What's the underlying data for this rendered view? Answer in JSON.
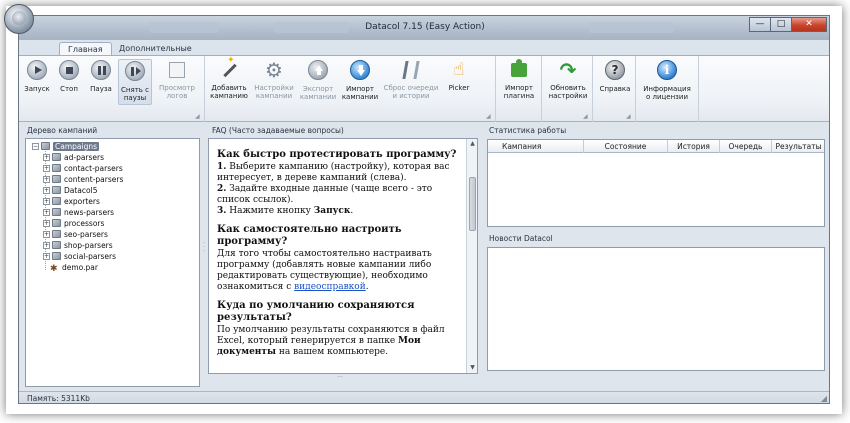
{
  "window": {
    "title": "Datacol 7.15 (Easy Action)",
    "controls": {
      "minimize": "—",
      "maximize": "□",
      "close": "✕"
    }
  },
  "ribbon": {
    "tabs": [
      {
        "label": "Главная",
        "active": true
      },
      {
        "label": "Дополнительные",
        "active": false
      }
    ],
    "buttons": {
      "start": {
        "line1": "Запуск",
        "line2": "",
        "icon": "play-icon",
        "enabled": true
      },
      "stop": {
        "line1": "Стоп",
        "line2": "",
        "icon": "stop-icon",
        "enabled": true
      },
      "pause": {
        "line1": "Пауза",
        "line2": "",
        "icon": "pause-icon",
        "enabled": true
      },
      "resume": {
        "line1": "Снять с",
        "line2": "паузы",
        "icon": "resume-icon",
        "enabled": true
      },
      "view_logs": {
        "line1": "Просмотр",
        "line2": "логов",
        "icon": "log-icon",
        "enabled": false
      },
      "add_campaign": {
        "line1": "Добавить",
        "line2": "кампанию",
        "icon": "wand-icon",
        "enabled": true
      },
      "campaign_settings": {
        "line1": "Настройки",
        "line2": "кампании",
        "icon": "gear-icon",
        "enabled": false
      },
      "export_campaign": {
        "line1": "Экспорт",
        "line2": "кампании",
        "icon": "export-icon",
        "enabled": false
      },
      "import_campaign": {
        "line1": "Импорт",
        "line2": "кампании",
        "icon": "import-icon",
        "enabled": true
      },
      "reset_queue": {
        "line1": "Сброс очереди",
        "line2": "и истории",
        "icon": "reset-icon",
        "enabled": false
      },
      "picker": {
        "line1": "Picker",
        "line2": "",
        "icon": "picker-hand-icon",
        "enabled": true
      },
      "import_plugin": {
        "line1": "Импорт",
        "line2": "плагина",
        "icon": "puzzle-icon",
        "enabled": true
      },
      "update_settings": {
        "line1": "Обновить",
        "line2": "настройки",
        "icon": "refresh-icon",
        "enabled": true
      },
      "help": {
        "line1": "Справка",
        "line2": "",
        "icon": "help-icon",
        "enabled": true
      },
      "license_info": {
        "line1": "Информация",
        "line2": "о лицензии",
        "icon": "info-icon",
        "enabled": true
      }
    }
  },
  "campaign_tree": {
    "header": "Дерево кампаний",
    "root": "Campaigns",
    "folders": [
      "ad-parsers",
      "contact-parsers",
      "content-parsers",
      "Datacol5",
      "exporters",
      "news-parsers",
      "processors",
      "seo-parsers",
      "shop-parsers",
      "social-parsers"
    ],
    "files": [
      "demo.par"
    ]
  },
  "faq": {
    "header": "FAQ (Часто задаваемые вопросы)",
    "q1": {
      "title": "Как быстро протестировать программу?",
      "n1": "1.",
      "s1": " Выберите кампанию (настройку), которая вас интересует, в дереве кампаний (слева).",
      "n2": "2.",
      "s2": " Задайте входные данные (чаще всего - это список ссылок).",
      "n3": "3.",
      "s3a": " Нажмите кнопку ",
      "s3b": "Запуск",
      "s3c": "."
    },
    "q2": {
      "title": "Как самостоятельно настроить программу?",
      "text": "Для того чтобы самостоятельно настраивать программу (добавлять новые кампании либо редактировать существующие), необходимо ознакомиться с ",
      "link": "видеосправкой",
      "tail": "."
    },
    "q3": {
      "title": "Куда по умолчанию сохраняются результаты?",
      "text": "По умолчанию результаты сохраняются в файл Excel, который генерируется в папке ",
      "bold": "Мои документы",
      "tail": " на вашем компьютере."
    }
  },
  "stats": {
    "header": "Статистика работы",
    "columns": [
      "Кампания",
      "Состояние",
      "История",
      "Очередь",
      "Результаты"
    ]
  },
  "news": {
    "header": "Новости Datacol"
  },
  "status": {
    "memory": "Память: 5311Kb"
  }
}
